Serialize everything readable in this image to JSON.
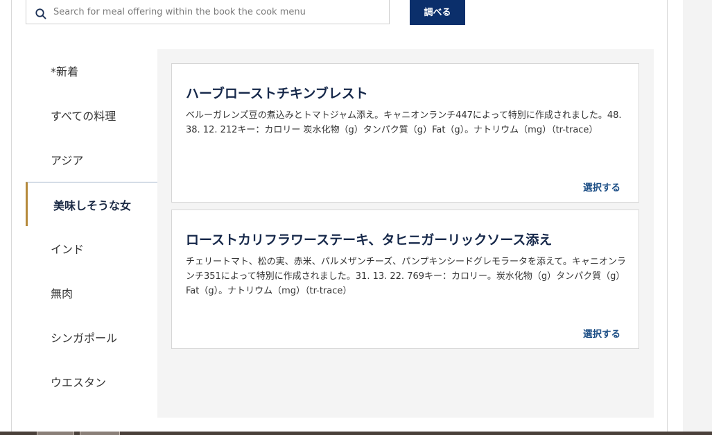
{
  "search": {
    "placeholder": "Search for meal offering within the book the cook menu",
    "button_label": "調べる"
  },
  "categories": [
    {
      "label": "*新着"
    },
    {
      "label": "すべての料理"
    },
    {
      "label": "アジア"
    },
    {
      "label": "美味しそうな女",
      "active": true
    },
    {
      "label": "インド"
    },
    {
      "label": "無肉"
    },
    {
      "label": "シンガポール"
    },
    {
      "label": "ウエスタン"
    }
  ],
  "meals": [
    {
      "title": "ハーブローストチキンブレスト",
      "description": "ベルーガレンズ豆の煮込みとトマトジャム添え。キャニオンランチ447によって特別に作成されました。48. 38. 12. 212キー：カロリー 炭水化物（g）タンパク質（g）Fat（g）。ナトリウム（mg）（tr-trace）",
      "select_label": "選択する"
    },
    {
      "title": "ローストカリフラワーステーキ、タヒニガーリックソース添え",
      "description": "チェリートマト、松の実、赤米、パルメザンチーズ、パンプキンシードグレモラータを添えて。キャニオンランチ351によって特別に作成されました。31. 13. 22. 769キー：カロリー。炭水化物（g）タンパク質（g）Fat（g）。ナトリウム（mg）（tr-trace）",
      "select_label": "選択する"
    }
  ],
  "colors": {
    "primary_button": "#0b2f6b",
    "active_accent": "#b5893a",
    "title": "#16284a",
    "link": "#1d4f86"
  }
}
